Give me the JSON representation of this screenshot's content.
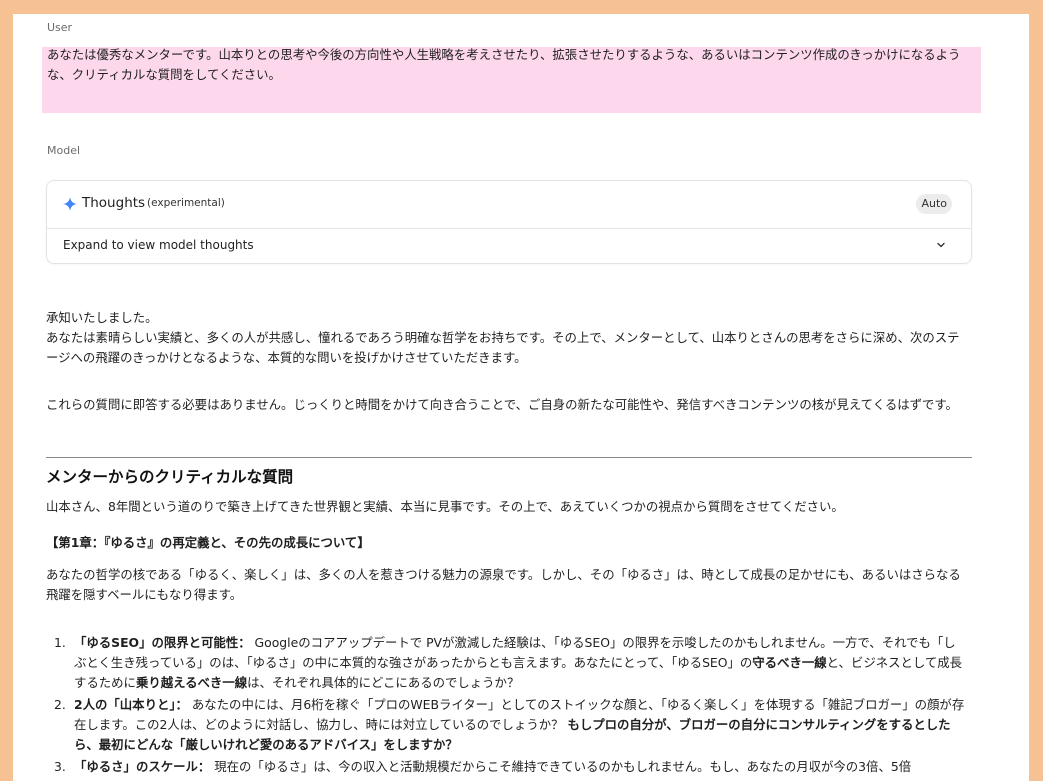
{
  "user": {
    "label": "User",
    "prompt": "あなたは優秀なメンターです。山本りとの思考や今後の方向性や人生戦略を考えさせたり、拡張させたりするような、あるいはコンテンツ作成のきっかけになるような、クリティカルな質問をしてください。"
  },
  "model": {
    "label": "Model",
    "thoughts": {
      "title": "Thoughts",
      "tag": "(experimental)",
      "mode": "Auto",
      "expand_label": "Expand to view model thoughts",
      "icon": "sparkle-icon"
    },
    "intro": [
      "承知いたしました。",
      "あなたは素晴らしい実績と、多くの人が共感し、憧れるであろう明確な哲学をお持ちです。その上で、メンターとして、山本りとさんの思考をさらに深め、次のステージへの飛躍のきっかけとなるような、本質的な問いを投げかけさせていただきます。"
    ],
    "note": "これらの質問に即答する必要はありません。じっくりと時間をかけて向き合うことで、ご自身の新たな可能性や、発信すべきコンテンツの核が見えてくるはずです。",
    "heading": "メンターからのクリティカルな質問",
    "lead": "山本さん、8年間という道のりで築き上げてきた世界観と実績、本当に見事です。その上で、あえていくつかの視点から質問をさせてください。",
    "chapter": "【第1章：『ゆるさ』の再定義と、その先の成長について】",
    "chapter_intro": "あなたの哲学の核である「ゆるく、楽しく」は、多くの人を惹きつける魅力の源泉です。しかし、その「ゆるさ」は、時として成長の足かせにも、あるいはさらなる飛躍を隠すベールにもなり得ます。",
    "questions": [
      {
        "num": "1.",
        "title": "「ゆるSEO」の限界と可能性：",
        "text_a": " Googleのコアアップデートで PVが激減した経験は、「ゆるSEO」の限界を示唆したのかもしれません。一方で、それでも「しぶとく生き残っている」のは、「ゆるさ」の中に本質的な強さがあったからとも言えます。あなたにとって、「ゆるSEO」の",
        "bold_a": "守るべき一線",
        "text_b": "と、ビジネスとして成長するために",
        "bold_b": "乗り越えるべき一線",
        "text_c": "は、それぞれ具体的にどこにあるのでしょうか？"
      },
      {
        "num": "2.",
        "title": "2人の「山本りと」：",
        "text_a": " あなたの中には、月6桁を稼ぐ「プロのWEBライター」としてのストイックな顔と、「ゆるく楽しく」を体現する「雑記ブロガー」の顔が存在します。この2人は、どのように対話し、協力し、時には対立しているのでしょうか？ ",
        "bold_a": "もしプロの自分が、ブロガーの自分にコンサルティングをするとしたら、最初にどんな「厳しいけれど愛のあるアドバイス」をしますか？",
        "text_b": "",
        "bold_b": "",
        "text_c": ""
      },
      {
        "num": "3.",
        "title": "「ゆるさ」のスケール：",
        "text_a": " 現在の「ゆるさ」は、今の収入と活動規模だからこそ維持できているのかもしれません。もし、あなたの月収が今の3倍、5倍",
        "bold_a": "",
        "text_b": "",
        "bold_b": "",
        "text_c": ""
      }
    ]
  },
  "colors": {
    "frame": "#f6c193",
    "user_highlight": "#fdd8ec",
    "sparkle": "#4285f4"
  }
}
